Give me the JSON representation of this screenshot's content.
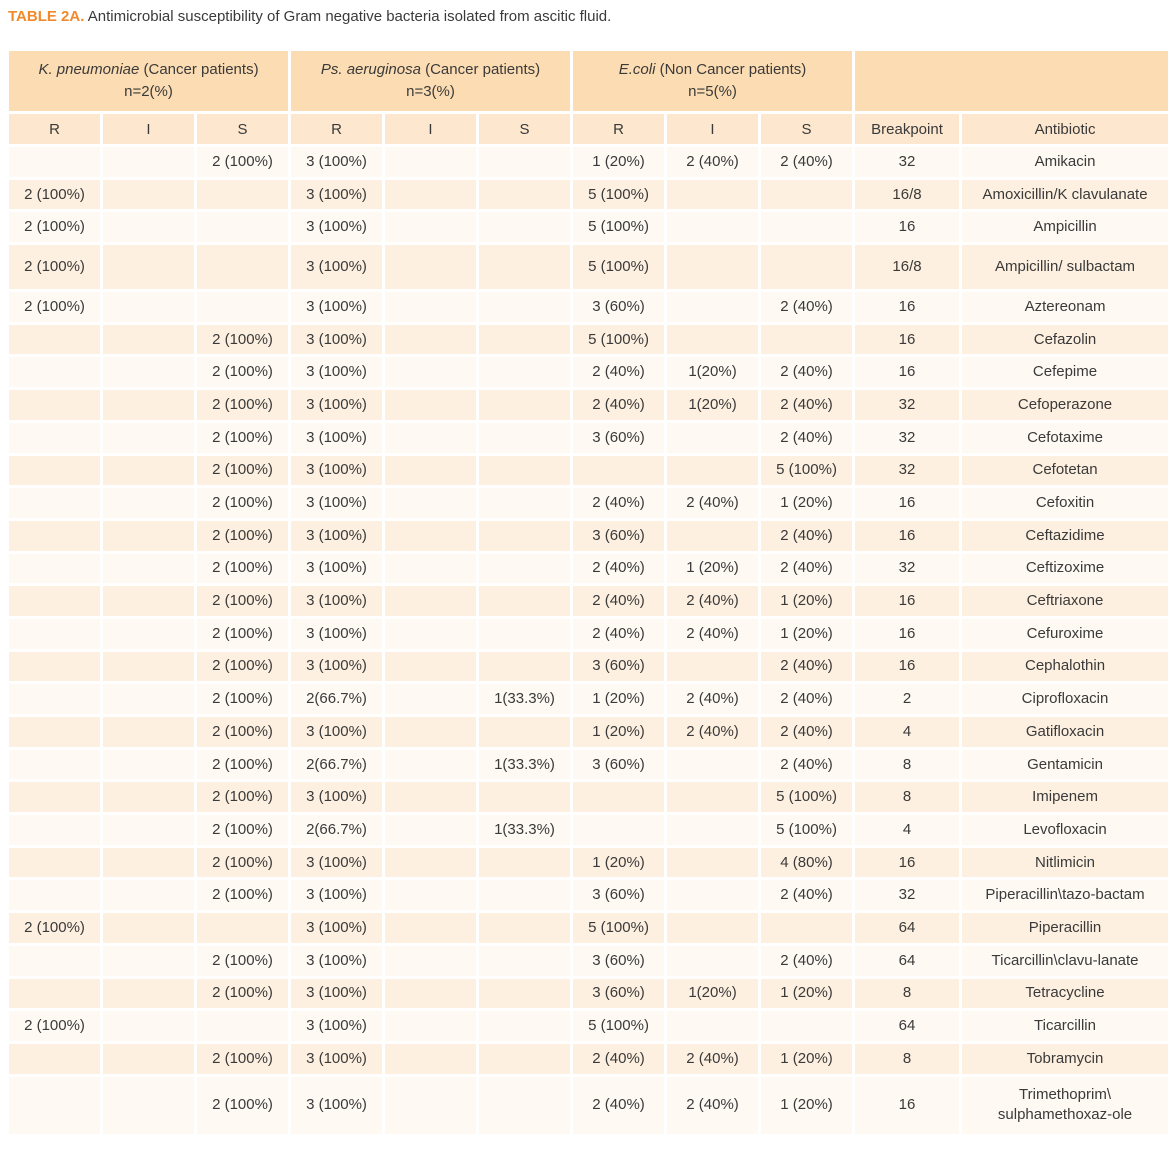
{
  "caption": {
    "label": "TABLE 2A.",
    "text": "Antimicrobial susceptibility of Gram negative bacteria isolated from ascitic fluid."
  },
  "groups": [
    {
      "organism": "K. pneumoniae",
      "patients": " (Cancer patients)",
      "n": "n=2(%)"
    },
    {
      "organism": "Ps. aeruginosa",
      "patients": " (Cancer patients)",
      "n": "n=3(%)"
    },
    {
      "organism": "E.coli",
      "patients": " (Non Cancer patients)",
      "n": "n=5(%)"
    }
  ],
  "subheaders": [
    "R",
    "I",
    "S",
    "R",
    "I",
    "S",
    "R",
    "I",
    "S",
    "Breakpoint",
    "Antibiotic"
  ],
  "rows": [
    [
      "",
      "",
      "2 (100%)",
      "3 (100%)",
      "",
      "",
      "1 (20%)",
      "2 (40%)",
      "2 (40%)",
      "32",
      "Amikacin"
    ],
    [
      "2 (100%)",
      "",
      "",
      "3 (100%)",
      "",
      "",
      "5 (100%)",
      "",
      "",
      "16/8",
      "Amoxicillin/K clavulanate"
    ],
    [
      "2 (100%)",
      "",
      "",
      "3 (100%)",
      "",
      "",
      "5 (100%)",
      "",
      "",
      "16",
      "Ampicillin"
    ],
    [
      "2 (100%)",
      "",
      "",
      "3 (100%)",
      "",
      "",
      "5 (100%)",
      "",
      "",
      "16/8",
      "Ampicillin/ sulbactam"
    ],
    [
      "2 (100%)",
      "",
      "",
      "3 (100%)",
      "",
      "",
      "3 (60%)",
      "",
      "2 (40%)",
      "16",
      "Aztereonam"
    ],
    [
      "",
      "",
      "2 (100%)",
      "3 (100%)",
      "",
      "",
      "5 (100%)",
      "",
      "",
      "16",
      "Cefazolin"
    ],
    [
      "",
      "",
      "2 (100%)",
      "3 (100%)",
      "",
      "",
      "2 (40%)",
      "1(20%)",
      "2 (40%)",
      "16",
      "Cefepime"
    ],
    [
      "",
      "",
      "2 (100%)",
      "3 (100%)",
      "",
      "",
      "2 (40%)",
      "1(20%)",
      "2 (40%)",
      "32",
      "Cefoperazone"
    ],
    [
      "",
      "",
      "2 (100%)",
      "3 (100%)",
      "",
      "",
      "3 (60%)",
      "",
      "2  (40%)",
      "32",
      "Cefotaxime"
    ],
    [
      "",
      "",
      "2 (100%)",
      "3 (100%)",
      "",
      "",
      "",
      "",
      "5 (100%)",
      "32",
      "Cefotetan"
    ],
    [
      "",
      "",
      "2 (100%)",
      "3 (100%)",
      "",
      "",
      "2 (40%)",
      "2 (40%)",
      "1  (20%)",
      "16",
      "Cefoxitin"
    ],
    [
      "",
      "",
      "2 (100%)",
      "3 (100%)",
      "",
      "",
      "3 (60%)",
      "",
      "2  (40%)",
      "16",
      "Ceftazidime"
    ],
    [
      "",
      "",
      "2 (100%)",
      "3 (100%)",
      "",
      "",
      "2 (40%)",
      "1 (20%)",
      "2   (40%)",
      "32",
      "Ceftizoxime"
    ],
    [
      "",
      "",
      "2 (100%)",
      "3 (100%)",
      "",
      "",
      "2  (40%)",
      "2 (40%)",
      "1 (20%)",
      "16",
      "Ceftriaxone"
    ],
    [
      "",
      "",
      "2 (100%)",
      "3 (100%)",
      "",
      "",
      "2 (40%)",
      "2 (40%)",
      "1 (20%)",
      "16",
      "Cefuroxime"
    ],
    [
      "",
      "",
      "2 (100%)",
      "3 (100%)",
      "",
      "",
      "3 (60%)",
      "",
      "2  (40%)",
      "16",
      "Cephalothin"
    ],
    [
      "",
      "",
      "2 (100%)",
      "2(66.7%)",
      "",
      "1(33.3%)",
      "1 (20%)",
      "2 (40%)",
      "2  (40%)",
      "2",
      "Ciprofloxacin"
    ],
    [
      "",
      "",
      "2 (100%)",
      "3 (100%)",
      "",
      "",
      "1  (20%)",
      "2 (40%)",
      "2  (40%)",
      "4",
      "Gatifloxacin"
    ],
    [
      "",
      "",
      "2 (100%)",
      "2(66.7%)",
      "",
      "1(33.3%)",
      "3 (60%)",
      "",
      "2  (40%)",
      "8",
      "Gentamicin"
    ],
    [
      "",
      "",
      "2 (100%)",
      "3 (100%)",
      "",
      "",
      "",
      "",
      "5  (100%)",
      "8",
      "Imipenem"
    ],
    [
      "",
      "",
      "2 (100%)",
      "2(66.7%)",
      "",
      "1(33.3%)",
      "",
      "",
      "5  (100%)",
      "4",
      "Levofloxacin"
    ],
    [
      "",
      "",
      "2 (100%)",
      "3 (100%)",
      "",
      "",
      "1 (20%)",
      "",
      "4 (80%)",
      "16",
      "Nitlimicin"
    ],
    [
      "",
      "",
      "2 (100%)",
      "3 (100%)",
      "",
      "",
      "3 (60%)",
      "",
      "2 (40%)",
      "32",
      "Piperacillin\\tazo-bactam"
    ],
    [
      "2 (100%)",
      "",
      "",
      "3 (100%)",
      "",
      "",
      "5 (100%)",
      "",
      "",
      "64",
      "Piperacillin"
    ],
    [
      "",
      "",
      "2 (100%)",
      "3 (100%)",
      "",
      "",
      "3  (60%)",
      "",
      "2 (40%)",
      "64",
      "Ticarcillin\\clavu-lanate"
    ],
    [
      "",
      "",
      "2 (100%)",
      "3 (100%)",
      "",
      "",
      "3  (60%)",
      "1(20%)",
      "1  (20%)",
      "8",
      "Tetracycline"
    ],
    [
      "2 (100%)",
      "",
      "",
      "3 (100%)",
      "",
      "",
      "5 (100%)",
      "",
      "",
      "64",
      "Ticarcillin"
    ],
    [
      "",
      "",
      "2 (100%)",
      "3 (100%)",
      "",
      "",
      "2 (40%)",
      "2 (40%)",
      "1 (20%)",
      "8",
      "Tobramycin"
    ],
    [
      "",
      "",
      "2 (100%)",
      "3 (100%)",
      "",
      "",
      "2 (40%)",
      "2 (40%)",
      "1  (20%)",
      "16",
      "Trimethoprim\\ sulphamethoxaz-ole"
    ]
  ]
}
